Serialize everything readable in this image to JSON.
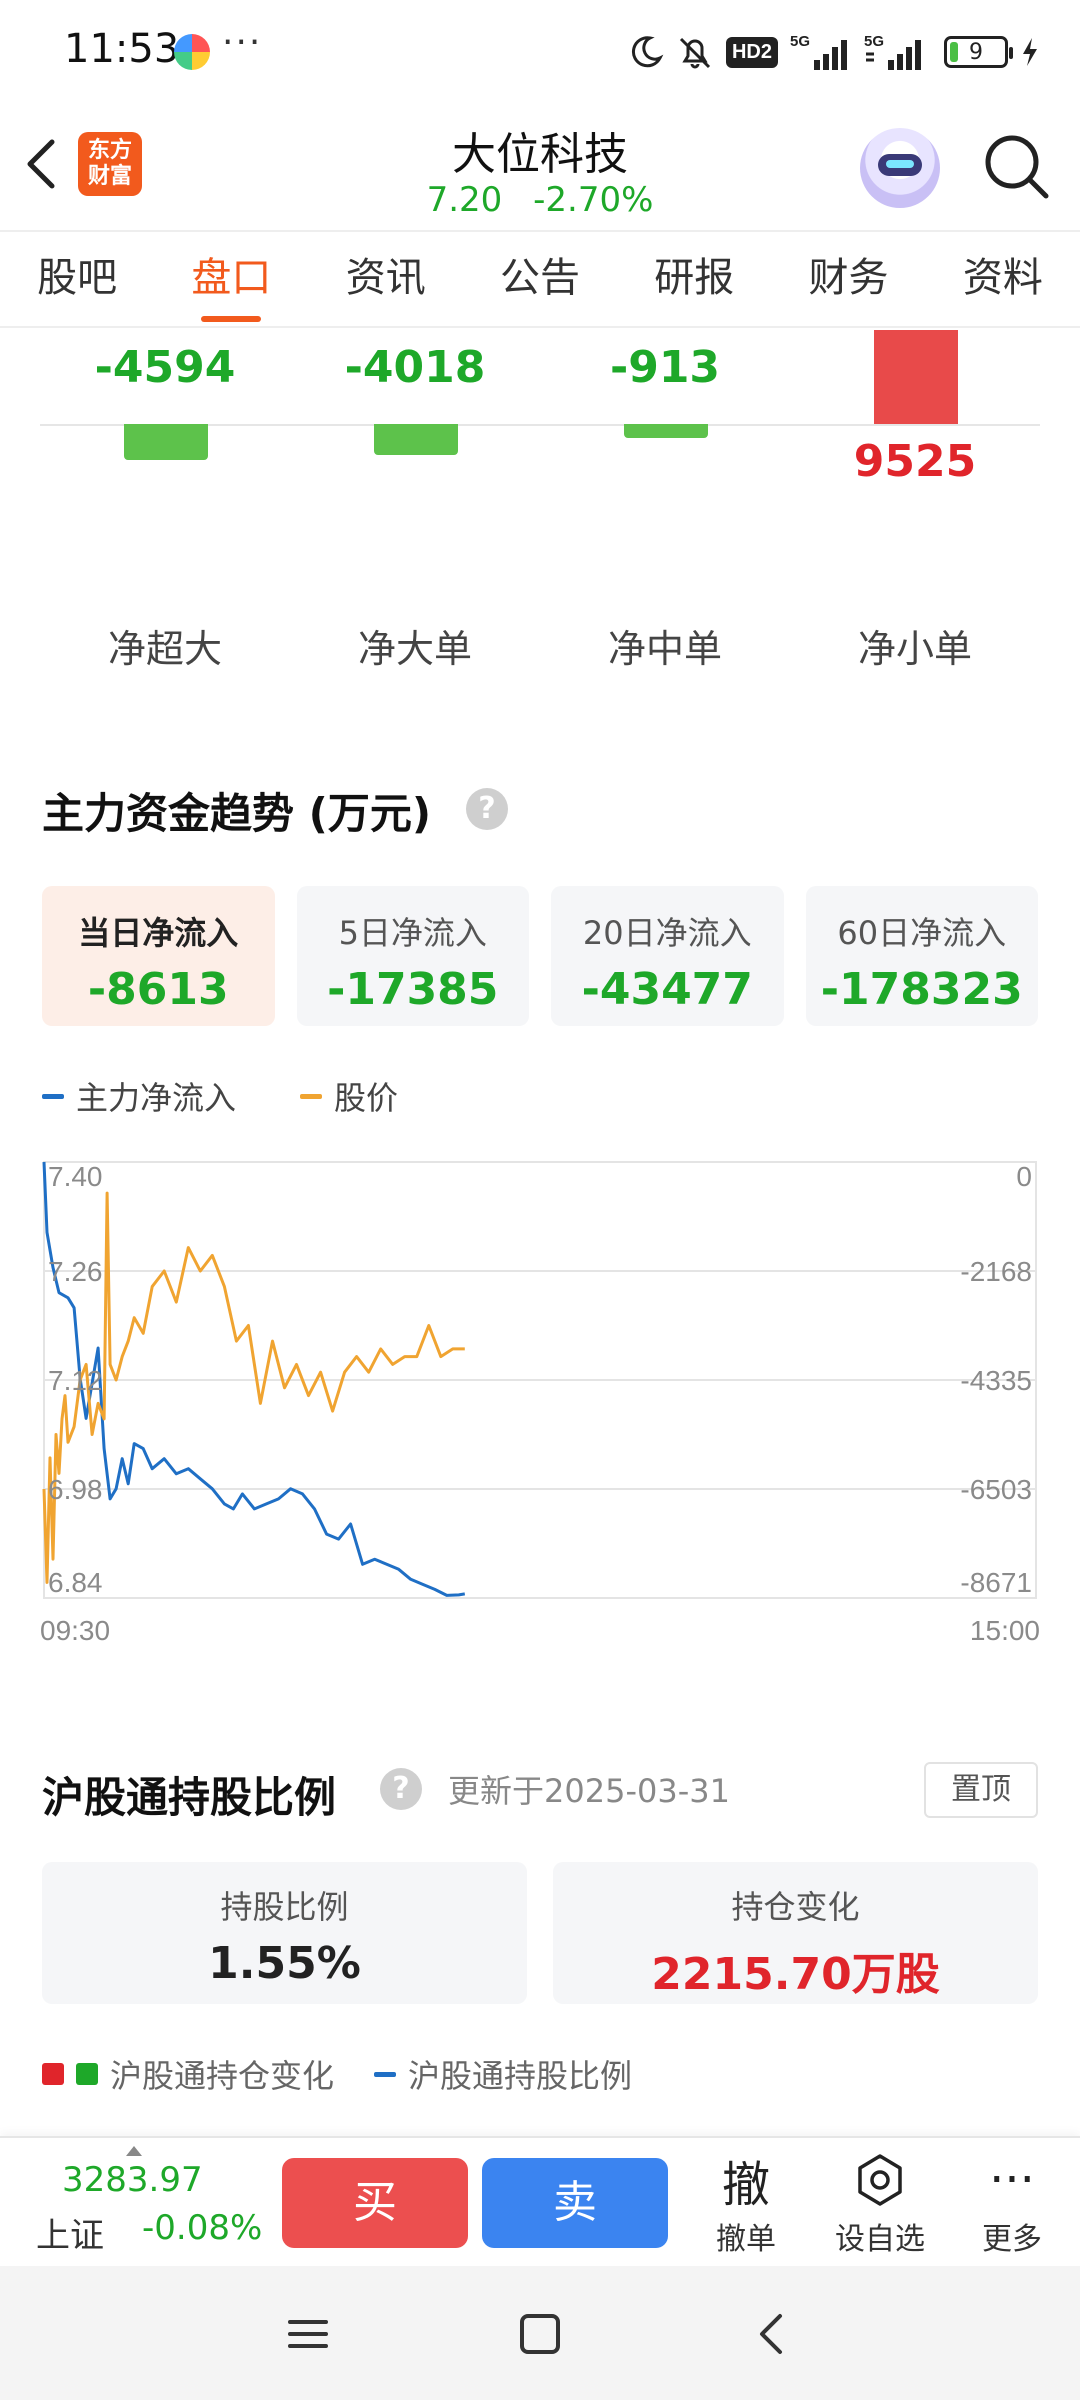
{
  "status_bar": {
    "time": "11:53",
    "more": "···",
    "hd_badge": "HD2",
    "signal1": "5G",
    "signal2": "5G",
    "battery": "9"
  },
  "header": {
    "logo_text_line1": "东方",
    "logo_text_line2": "财富",
    "stock_name": "大位科技",
    "price": "7.20",
    "change_pct": "-2.70%"
  },
  "tabs": [
    {
      "label": "股吧",
      "active": false
    },
    {
      "label": "盘口",
      "active": true
    },
    {
      "label": "资讯",
      "active": false
    },
    {
      "label": "公告",
      "active": false
    },
    {
      "label": "研报",
      "active": false
    },
    {
      "label": "财务",
      "active": false
    },
    {
      "label": "资料",
      "active": false
    }
  ],
  "flow_bars": {
    "items": [
      {
        "label": "净超大",
        "value": -4594,
        "display": "-4594"
      },
      {
        "label": "净大单",
        "value": -4018,
        "display": "-4018"
      },
      {
        "label": "净中单",
        "value": -913,
        "display": "-913"
      },
      {
        "label": "净小单",
        "value": 9525,
        "display": "9525"
      }
    ]
  },
  "trend": {
    "title": "主力资金趋势 (万元)",
    "help": "?",
    "periods": [
      {
        "label": "当日净流入",
        "value": "-8613",
        "active": true
      },
      {
        "label": "5日净流入",
        "value": "-17385",
        "active": false
      },
      {
        "label": "20日净流入",
        "value": "-43477",
        "active": false
      },
      {
        "label": "60日净流入",
        "value": "-178323",
        "active": false
      }
    ],
    "legend": [
      {
        "label": "主力净流入",
        "color": "#1f6fc5"
      },
      {
        "label": "股价",
        "color": "#f0a431"
      }
    ]
  },
  "chart_data": {
    "type": "line",
    "title": "",
    "x_start": "09:30",
    "x_end": "15:00",
    "left_axis_ticks": [
      "7.40",
      "7.26",
      "7.12",
      "6.98",
      "6.84"
    ],
    "right_axis_ticks": [
      "0",
      "-2168",
      "-4335",
      "-6503",
      "-8671"
    ],
    "left_ylim": [
      6.84,
      7.4
    ],
    "right_ylim": [
      -8671,
      0
    ],
    "grid": true,
    "series": [
      {
        "name": "主力净流入",
        "axis": "right",
        "color": "#1f6fc5",
        "x_minutes": [
          0,
          1,
          3,
          5,
          8,
          10,
          12,
          14,
          16,
          18,
          20,
          22,
          24,
          26,
          28,
          30,
          33,
          36,
          40,
          44,
          48,
          52,
          56,
          60,
          63,
          66,
          70,
          74,
          78,
          82,
          86,
          90,
          94,
          98,
          102,
          106,
          110,
          114,
          118,
          122,
          126,
          130,
          134,
          138,
          140
        ],
        "values": [
          0,
          -1400,
          -2100,
          -2600,
          -2700,
          -2900,
          -4300,
          -5100,
          -4400,
          -3700,
          -5700,
          -6700,
          -6500,
          -5900,
          -6400,
          -5600,
          -5700,
          -6100,
          -5900,
          -6200,
          -6100,
          -6300,
          -6500,
          -6800,
          -6900,
          -6600,
          -6900,
          -6800,
          -6700,
          -6500,
          -6600,
          -6900,
          -7400,
          -7500,
          -7200,
          -8000,
          -7900,
          -8000,
          -8100,
          -8300,
          -8400,
          -8500,
          -8620,
          -8610,
          -8590
        ]
      },
      {
        "name": "股价",
        "axis": "left",
        "color": "#f0a431",
        "x_minutes": [
          0,
          1,
          2,
          3,
          4,
          5,
          6,
          7,
          8,
          10,
          12,
          14,
          16,
          18,
          20,
          21,
          22,
          24,
          26,
          28,
          30,
          33,
          36,
          40,
          44,
          48,
          52,
          56,
          60,
          64,
          68,
          72,
          76,
          80,
          84,
          88,
          92,
          96,
          100,
          104,
          108,
          112,
          116,
          120,
          124,
          128,
          132,
          136,
          140
        ],
        "values": [
          6.98,
          6.86,
          7.02,
          6.89,
          7.05,
          7.0,
          7.07,
          7.1,
          7.04,
          7.06,
          7.12,
          7.14,
          7.05,
          7.09,
          7.07,
          7.36,
          7.14,
          7.12,
          7.15,
          7.17,
          7.2,
          7.18,
          7.24,
          7.26,
          7.22,
          7.29,
          7.26,
          7.28,
          7.24,
          7.17,
          7.19,
          7.09,
          7.17,
          7.11,
          7.14,
          7.1,
          7.13,
          7.08,
          7.13,
          7.15,
          7.13,
          7.16,
          7.14,
          7.15,
          7.15,
          7.19,
          7.15,
          7.16,
          7.16
        ]
      }
    ]
  },
  "hsgt": {
    "title": "沪股通持股比例",
    "help": "?",
    "update_text": "更新于2025-03-31",
    "top_button": "置顶",
    "cards": [
      {
        "label": "持股比例",
        "value": "1.55%",
        "red": false
      },
      {
        "label": "持仓变化",
        "value": "2215.70万股",
        "red": true
      }
    ],
    "legend": [
      {
        "label": "沪股通持仓变化",
        "colors": [
          "#e0252b",
          "#1ea829"
        ]
      },
      {
        "label": "沪股通持股比例",
        "color": "#1f6fc5"
      }
    ]
  },
  "bottom_bar": {
    "index_value": "3283.97",
    "index_name": "上证",
    "index_change": "-0.08%",
    "buy": "买",
    "sell": "卖",
    "actions": [
      {
        "label": "撤单",
        "icon_text": "撤"
      },
      {
        "label": "设自选",
        "icon_text": ""
      },
      {
        "label": "更多",
        "icon_text": "···"
      }
    ]
  }
}
